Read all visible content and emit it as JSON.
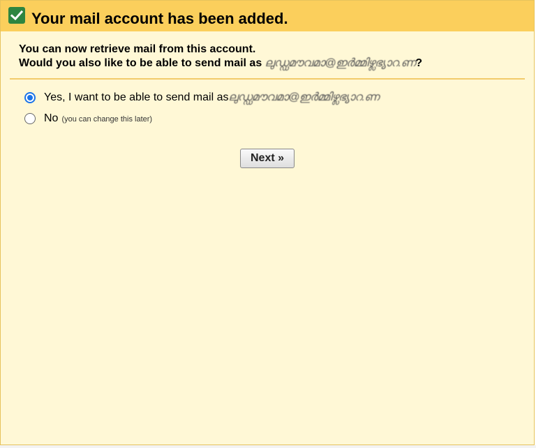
{
  "dialog": {
    "title": "Your mail account has been added.",
    "intro_line1": "You can now retrieve mail from this account.",
    "intro_line2_prefix": "Would you also like to be able to send mail as ",
    "redacted_address": "ലുഡ്ഡമൗവമാ@ഇർമ്മിഴ്ലഭ്യാറ.ണ",
    "intro_line2_suffix": "?",
    "options": {
      "yes_label": "Yes, I want to be able to send mail as ",
      "no_label": "No",
      "no_note": "(you can change this later)"
    },
    "next_button": "Next »"
  },
  "colors": {
    "header_bg": "#fbcf5c",
    "body_bg": "#fff8d6",
    "check_green": "#2e8540",
    "radio_blue": "#1a73e8"
  }
}
